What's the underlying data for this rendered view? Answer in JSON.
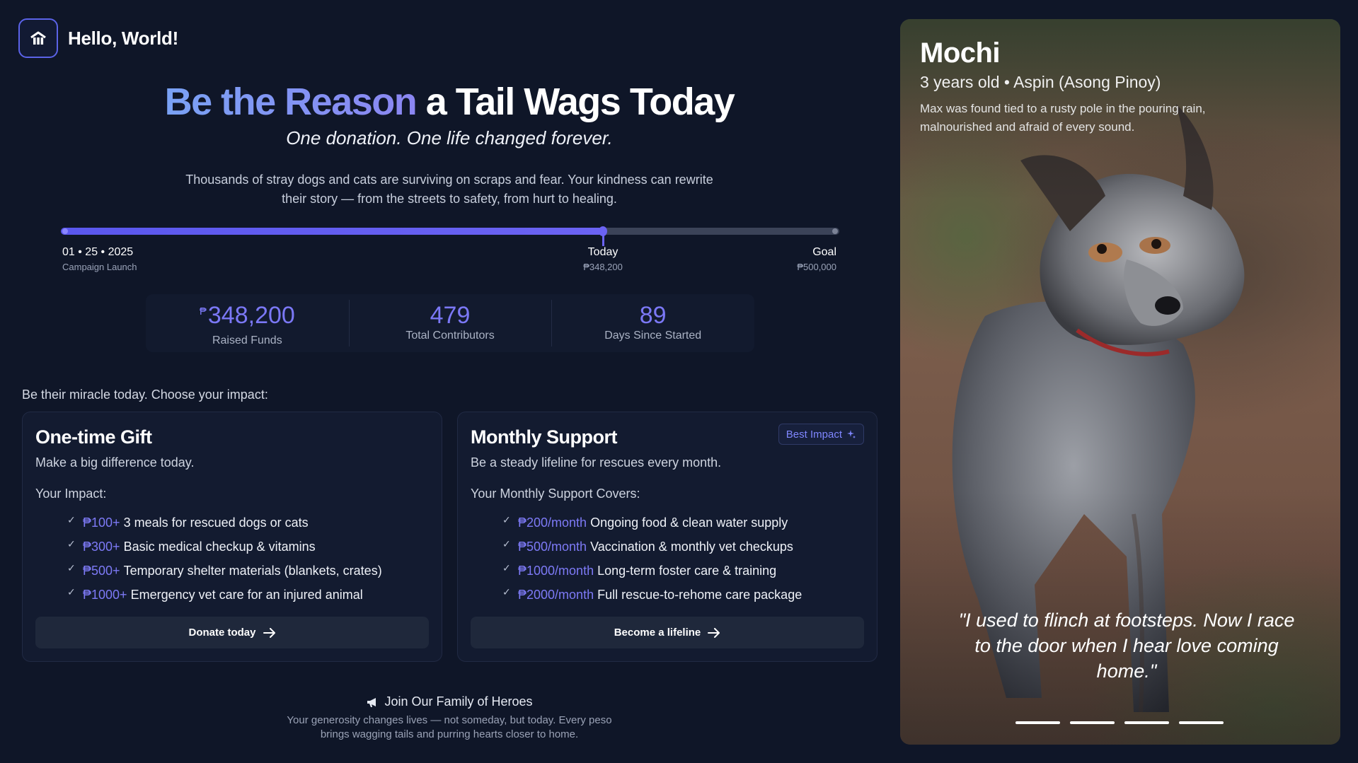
{
  "brand": {
    "name": "Hello, World!",
    "icon": "home-paw-icon"
  },
  "hero": {
    "title_accent": "Be the Reason",
    "title_rest": " a Tail Wags Today",
    "subtitle": "One donation. One life changed forever.",
    "description": "Thousands of stray dogs and cats are surviving on scraps and fear. Your kindness can rewrite their story — from the streets to safety, from hurt to healing."
  },
  "progress": {
    "fraction": 0.6964,
    "start": {
      "label": "01 • 25 • 2025",
      "sub": "Campaign Launch"
    },
    "today": {
      "label": "Today",
      "sub": "₱348,200"
    },
    "goal": {
      "label": "Goal",
      "sub": "₱500,000"
    }
  },
  "stats": [
    {
      "currency": "₱",
      "value": "348,200",
      "label": "Raised Funds"
    },
    {
      "currency": "",
      "value": "479",
      "label": "Total Contributors"
    },
    {
      "currency": "",
      "value": "89",
      "label": "Days Since Started"
    }
  ],
  "choose_text": "Be their miracle today. Choose your impact:",
  "one_time": {
    "title": "One-time Gift",
    "subtitle": "Make a big difference today.",
    "impact_heading": "Your Impact:",
    "items": [
      {
        "amount": "₱100+",
        "text": "3 meals for rescued dogs or cats"
      },
      {
        "amount": "₱300+",
        "text": "Basic medical checkup & vitamins"
      },
      {
        "amount": "₱500+",
        "text": "Temporary shelter materials (blankets, crates)"
      },
      {
        "amount": "₱1000+",
        "text": "Emergency vet care for an injured animal"
      }
    ],
    "button": "Donate today"
  },
  "monthly": {
    "title": "Monthly Support",
    "badge": "Best Impact",
    "subtitle": "Be a steady lifeline for rescues every month.",
    "impact_heading": "Your Monthly Support Covers:",
    "items": [
      {
        "amount": "₱200/month",
        "text": "Ongoing food & clean water supply"
      },
      {
        "amount": "₱500/month",
        "text": "Vaccination & monthly vet checkups"
      },
      {
        "amount": "₱1000/month",
        "text": "Long-term foster care & training"
      },
      {
        "amount": "₱2000/month",
        "text": "Full rescue-to-rehome care package"
      }
    ],
    "button": "Become a lifeline"
  },
  "footer": {
    "title": "Join Our Family of Heroes",
    "text": "Your generosity changes lives — not someday, but today. Every peso brings wagging tails and purring hearts closer to home."
  },
  "pet": {
    "name": "Mochi",
    "meta": "3 years old • Aspin (Asong Pinoy)",
    "story": "Max was found tied to a rusty pole in the pouring rain, malnourished and afraid of every sound.",
    "quote": "\"I used to flinch at footsteps. Now I race to the door when I hear love coming home.\"",
    "slides": 4
  },
  "colors": {
    "background": "#0f1628",
    "accent": "#6b63f3",
    "amount": "#7d7af6",
    "card": "#131b30"
  }
}
